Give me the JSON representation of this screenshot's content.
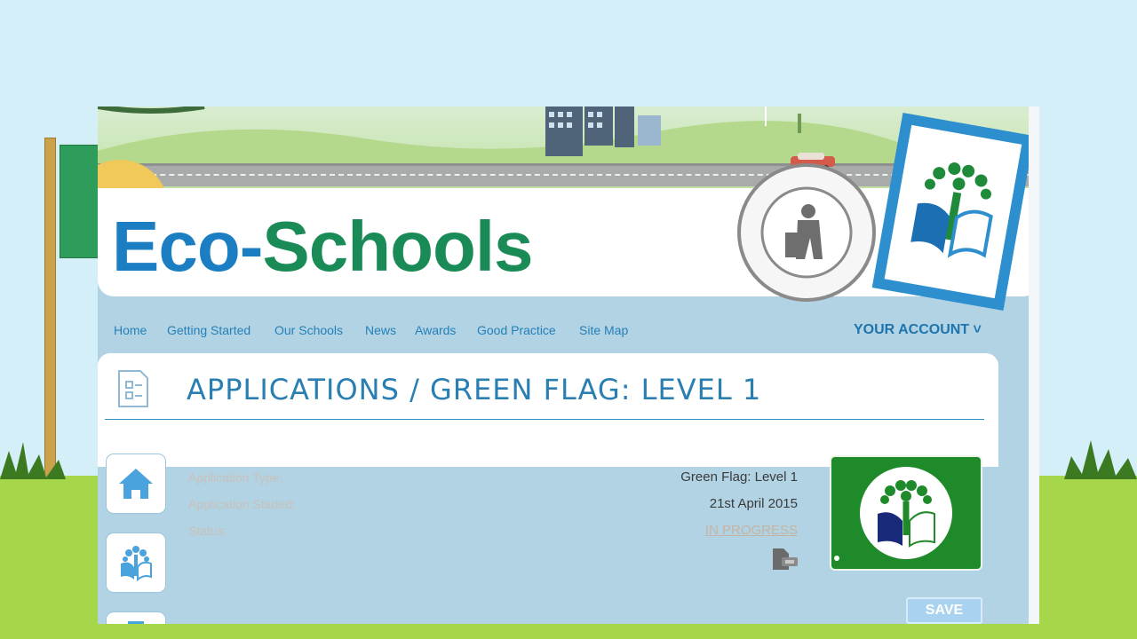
{
  "brand": {
    "eco": "Eco",
    "dash": "-",
    "schools": "Schools",
    "partner_logo": "Keep Wales Tidy"
  },
  "nav": {
    "items": [
      "Home",
      "Getting Started",
      "Our Schools",
      "News",
      "Awards",
      "Good Practice",
      "Site Map"
    ],
    "account": "YOUR ACCOUNT ˅"
  },
  "page": {
    "title": "APPLICATIONS / GREEN FLAG: LEVEL 1"
  },
  "details": {
    "application_type": {
      "label": "Application Type:",
      "value": "Green Flag: Level 1"
    },
    "application_started": {
      "label": "Application Started:",
      "value": "21st April 2015"
    },
    "status": {
      "label": "Status:",
      "value": "IN PROGRESS"
    }
  },
  "actions": {
    "save_label": "SAVE"
  },
  "colors": {
    "brand_blue": "#1b7ec2",
    "brand_green": "#1a8a56",
    "nav_link": "#2480b8",
    "award_green": "#1f8a2a",
    "panel_bg": "#b1d3e4"
  },
  "icons": {
    "side_nav": [
      "home-icon",
      "eco-tree-icon",
      "list-icon"
    ],
    "title": "document-checklist-icon",
    "download": "pdf-download-icon"
  }
}
